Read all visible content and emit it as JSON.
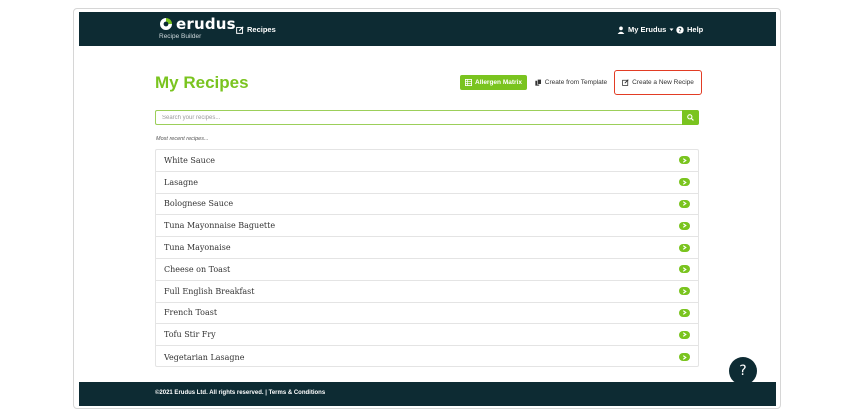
{
  "brand": {
    "name": "erudus",
    "subtitle": "Recipe Builder",
    "accent_color": "#7ac41f",
    "nav_bg_color": "#0d2b33"
  },
  "nav": {
    "recipes_label": "Recipes",
    "account_label": "My Erudus",
    "help_label": "Help"
  },
  "page": {
    "title": "My Recipes"
  },
  "actions": {
    "allergen_matrix": "Allergen Matrix",
    "create_from_template": "Create from Template",
    "create_new_recipe": "Create a New Recipe"
  },
  "search": {
    "placeholder": "Search your recipes..."
  },
  "recent": {
    "label": "Most recent recipes...",
    "items": [
      "White Sauce",
      "Lasagne",
      "Bolognese Sauce",
      "Tuna Mayonnaise Baguette",
      "Tuna Mayonaise",
      "Cheese on Toast",
      "Full English Breakfast",
      "French Toast",
      "Tofu Stir Fry",
      "Vegetarian Lasagne"
    ]
  },
  "help_bubble": {
    "label": "?"
  },
  "footer": {
    "copyright": "©2021 Erudus Ltd. All rights reserved.",
    "separator": " | ",
    "terms_link": "Terms & Conditions"
  }
}
